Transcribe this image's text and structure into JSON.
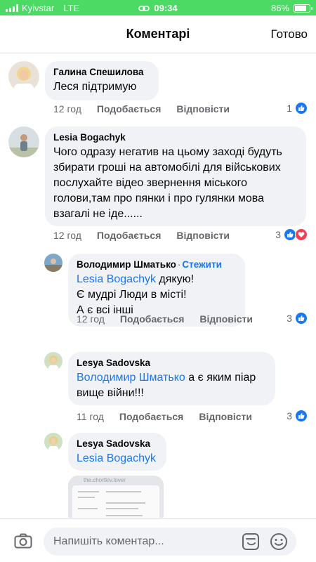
{
  "status_bar": {
    "carrier": "Kyivstar",
    "network": "LTE",
    "time": "09:34",
    "battery": "86%",
    "battery_level": 0.86
  },
  "header": {
    "title": "Коментарі",
    "done": "Готово"
  },
  "comments": [
    {
      "author": "Галина Спешилова",
      "text": "Леся підтримую",
      "time": "12 год",
      "like_label": "Подобається",
      "reply_label": "Відповісти",
      "reaction_count": "1"
    },
    {
      "author": "Lesia Bogachyk",
      "text_lines": [
        "Чого одразу негатив на цьому заході будуть",
        "збирати гроші на автомобілі для військових",
        "послухайте відео звернення міського",
        "голови,там про пянки і про гулянки мова",
        "взагалі не  іде......"
      ],
      "time": "12 год",
      "like_label": "Подобається",
      "reply_label": "Відповісти",
      "reaction_count": "3"
    }
  ],
  "replies": [
    {
      "author": "Володимир Шматько",
      "follow": "Стежити",
      "mention": "Lesia Bogachyk",
      "text_after_mention": " дякую!",
      "text_lines": [
        "Є мудрі Люди в місті!",
        "А є всі інші"
      ],
      "time": "12 год",
      "like_label": "Подобається",
      "reply_label": "Відповісти",
      "reaction_count": "3"
    },
    {
      "author": "Lesya Sadovska",
      "mention": "Володимир Шматько",
      "text_after_mention": " а є яким піар",
      "text_lines": [
        "вище війни!!!"
      ],
      "time": "11 год",
      "like_label": "Подобається",
      "reply_label": "Відповісти",
      "reaction_count": "3"
    },
    {
      "author": "Lesya Sadovska",
      "mention": "Lesia Bogachyk",
      "image_caption": "the.chortkiv.lover"
    }
  ],
  "composer": {
    "placeholder": "Напишіть коментар..."
  },
  "colors": {
    "status_green": "#4cd964",
    "link_blue": "#1877f2",
    "bubble_gray": "#f0f2f5",
    "love_red": "#f33e58"
  }
}
